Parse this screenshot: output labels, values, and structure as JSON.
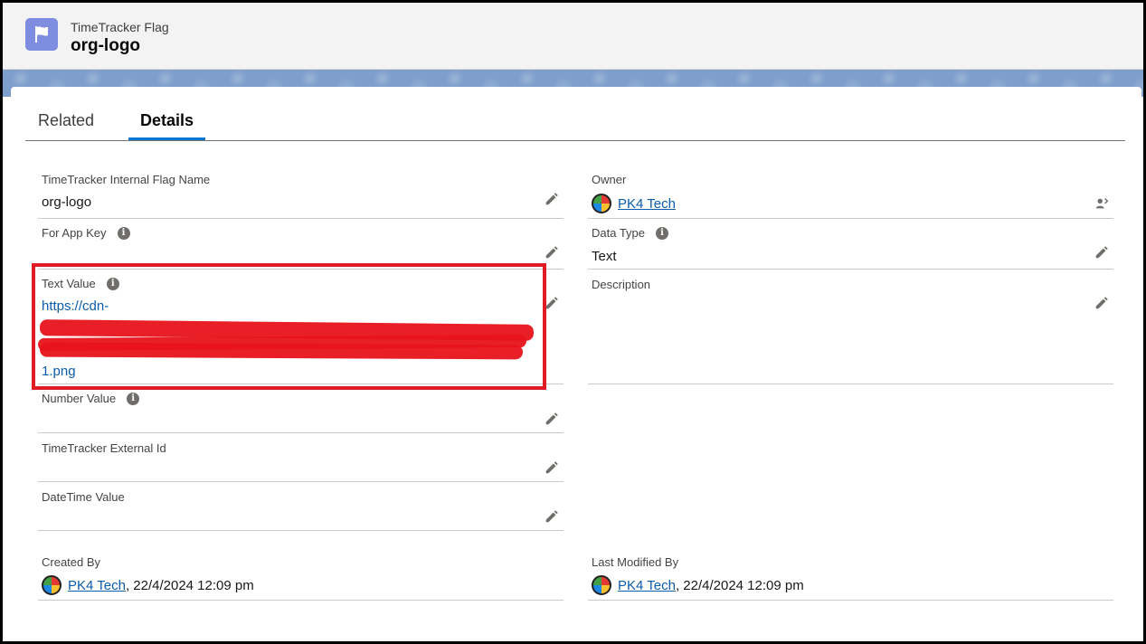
{
  "header": {
    "object_label": "TimeTracker Flag",
    "record_title": "org-logo",
    "icon": "flag-icon"
  },
  "tabs": [
    {
      "label": "Related",
      "active": false
    },
    {
      "label": "Details",
      "active": true
    }
  ],
  "left_fields": {
    "internal_flag_name": {
      "label": "TimeTracker Internal Flag Name",
      "value": "org-logo"
    },
    "for_app_key": {
      "label": "For App Key",
      "value": ""
    },
    "text_value": {
      "label": "Text Value",
      "value_start": "https://cdn-",
      "value_end": "1.png"
    },
    "number_value": {
      "label": "Number Value",
      "value": ""
    },
    "external_id": {
      "label": "TimeTracker External Id",
      "value": ""
    },
    "datetime_value": {
      "label": "DateTime Value",
      "value": ""
    },
    "created_by": {
      "label": "Created By",
      "user": "PK4 Tech",
      "timestamp": ", 22/4/2024 12:09 pm"
    }
  },
  "right_fields": {
    "owner": {
      "label": "Owner",
      "user": "PK4 Tech"
    },
    "data_type": {
      "label": "Data Type",
      "value": "Text"
    },
    "description": {
      "label": "Description",
      "value": ""
    },
    "last_modified_by": {
      "label": "Last Modified By",
      "user": "PK4 Tech",
      "timestamp": ", 22/4/2024 12:09 pm"
    }
  },
  "colors": {
    "accent": "#0176d3",
    "link": "#0b5cab",
    "highlight": "#e01b24",
    "object_icon": "#7f8de1"
  }
}
